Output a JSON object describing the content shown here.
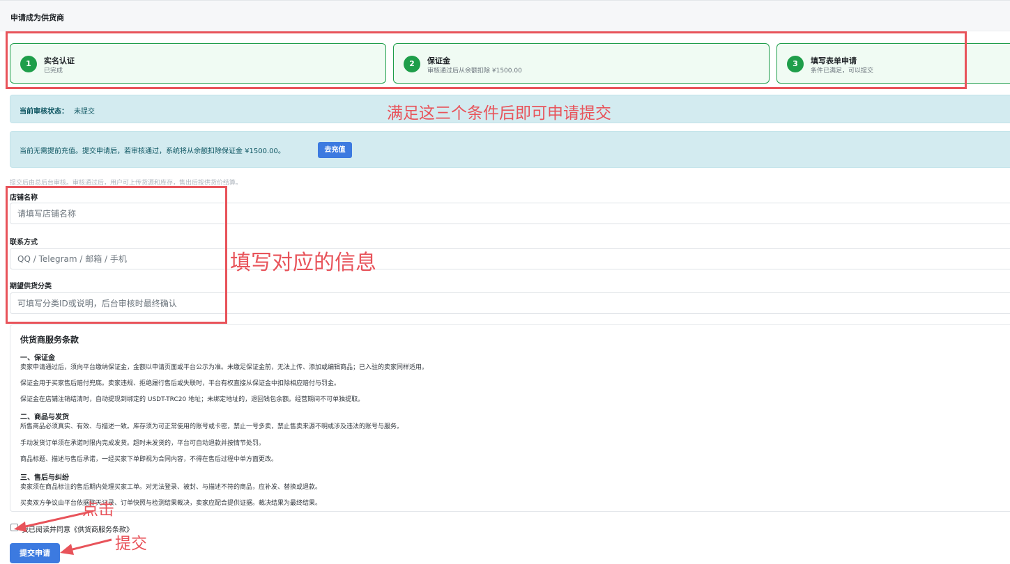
{
  "page": {
    "title": "申请成为供货商"
  },
  "steps": [
    {
      "num": "1",
      "title": "实名认证",
      "desc": "已完成"
    },
    {
      "num": "2",
      "title": "保证金",
      "desc": "审核通过后从余额扣除 ¥1500.00"
    },
    {
      "num": "3",
      "title": "填写表单申请",
      "desc": "条件已满足，可以提交"
    }
  ],
  "status": {
    "label": "当前审核状态：",
    "value": "未提交"
  },
  "recharge": {
    "text": "当前无需提前充值。提交申请后，若审核通过，系统将从余额扣除保证金 ¥1500.00。",
    "button": "去充值"
  },
  "hint": "提交后由总后台审核。审核通过后，用户可上传货源和库存，售出后按供货价结算。",
  "form": {
    "store_name": {
      "label": "店铺名称",
      "placeholder": "请填写店铺名称"
    },
    "contact": {
      "label": "联系方式",
      "placeholder": "QQ / Telegram / 邮箱 / 手机"
    },
    "category": {
      "label": "期望供货分类",
      "placeholder": "可填写分类ID或说明，后台审核时最终确认"
    }
  },
  "terms": {
    "title": "供货商服务条款",
    "sections": [
      {
        "heading": "一、保证金",
        "paragraphs": [
          "卖家申请通过后，须向平台缴纳保证金，金额以申请页面或平台公示为准。未缴足保证金前，无法上传、添加或编辑商品；已入驻的卖家同样适用。",
          "保证金用于买家售后赔付兜底。卖家违规、拒绝履行售后或失联时，平台有权直接从保证金中扣除相应赔付与罚金。",
          "保证金在店铺注销结清时，自动提现到绑定的 USDT-TRC20 地址；未绑定地址的，退回钱包余额。经营期间不可单独提取。"
        ]
      },
      {
        "heading": "二、商品与发货",
        "paragraphs": [
          "所售商品必须真实、有效、与描述一致。库存须为可正常使用的账号或卡密，禁止一号多卖，禁止售卖来源不明或涉及违法的账号与服务。",
          "手动发货订单须在承诺时限内完成发货。超时未发货的，平台可自动退款并按情节处罚。",
          "商品标题、描述与售后承诺，一经买家下单即视为合同内容，不得在售后过程中单方面更改。"
        ]
      },
      {
        "heading": "三、售后与纠纷",
        "paragraphs": [
          "卖家须在商品标注的售后期内处理买家工单。对无法登录、被封、与描述不符的商品，应补发、替换或退款。",
          "买卖双方争议由平台依据聊天记录、订单快照与检测结果裁决，卖家应配合提供证据。裁决结果为最终结果。"
        ]
      }
    ]
  },
  "agree": {
    "text": "我已阅读并同意《供货商服务条款》",
    "checked": false
  },
  "submit": {
    "label": "提交申请"
  },
  "annotations": {
    "steps_note": "满足这三个条件后即可申请提交",
    "form_note": "填写对应的信息",
    "click_note": "点击",
    "submit_note": "提交",
    "color": "#e8535a"
  },
  "colors": {
    "step_green": "#1e9e4a",
    "info_bg": "#d3ebf0",
    "primary": "#3c7ae0"
  }
}
